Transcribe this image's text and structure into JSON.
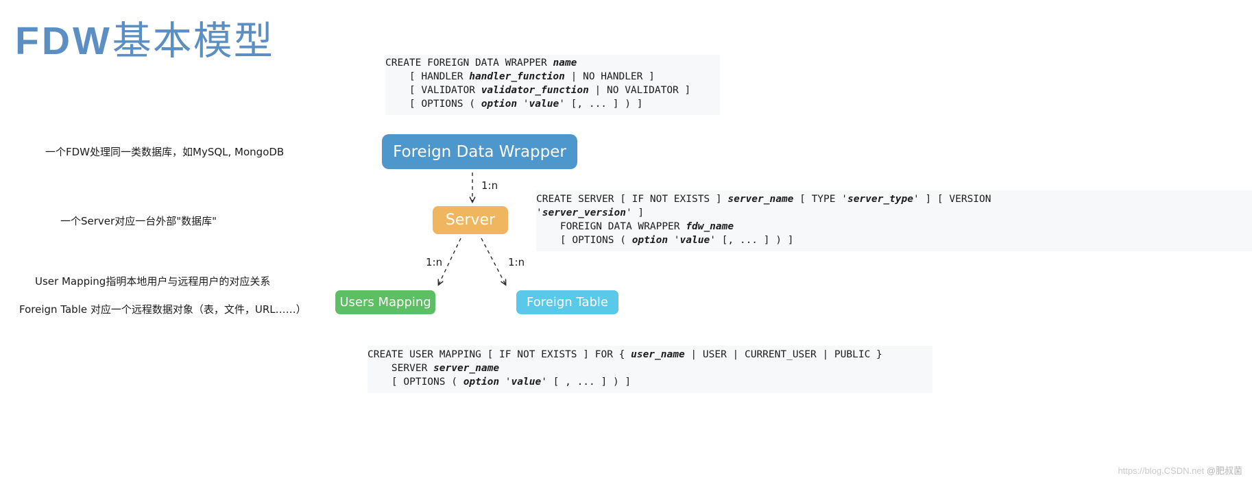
{
  "title": {
    "latin": "FDW",
    "cjk": "基本模型"
  },
  "colors": {
    "title": "#5b8fc4",
    "fdw_box": "#4d97cd",
    "server_box": "#efb65f",
    "users_mapping_box": "#5cbf63",
    "foreign_table_box": "#5ac8e8",
    "code_background": "#f7f8fa",
    "arrow": "#2b2b2b"
  },
  "nodes": {
    "fdw": "Foreign Data Wrapper",
    "server": "Server",
    "users_mapping": "Users Mapping",
    "foreign_table": "Foreign Table"
  },
  "edges": {
    "fdw_to_server": "1:n",
    "server_to_users_mapping": "1:n",
    "server_to_foreign_table": "1:n"
  },
  "notes": {
    "fdw": "一个FDW处理同一类数据库，如MySQL, MongoDB",
    "server": "一个Server对应一台外部\"数据库\"",
    "users_mapping": "User Mapping指明本地用户与远程用户的对应关系",
    "foreign_table": "Foreign Table 对应一个远程数据对象（表，文件，URL……）"
  },
  "code_blocks": {
    "create_foreign_data_wrapper": {
      "lines": [
        "CREATE FOREIGN DATA WRAPPER name",
        "    [ HANDLER handler_function | NO HANDLER ]",
        "    [ VALIDATOR validator_function | NO VALIDATOR ]",
        "    [ OPTIONS ( option 'value' [, ... ] ) ]"
      ]
    },
    "create_server": {
      "lines": [
        "CREATE SERVER [ IF NOT EXISTS ] server_name [ TYPE 'server_type' ] [ VERSION",
        "'server_version' ]",
        "    FOREIGN DATA WRAPPER fdw_name",
        "    [ OPTIONS ( option 'value' [, ... ] ) ]"
      ]
    },
    "create_user_mapping": {
      "lines": [
        "CREATE USER MAPPING [ IF NOT EXISTS ] FOR { user_name | USER | CURRENT_USER | PUBLIC }",
        "    SERVER server_name",
        "    [ OPTIONS ( option 'value' [ , ... ] ) ]"
      ]
    }
  },
  "watermark": {
    "url": "https://blog.CSDN.net",
    "author": "@肥叔菌"
  }
}
